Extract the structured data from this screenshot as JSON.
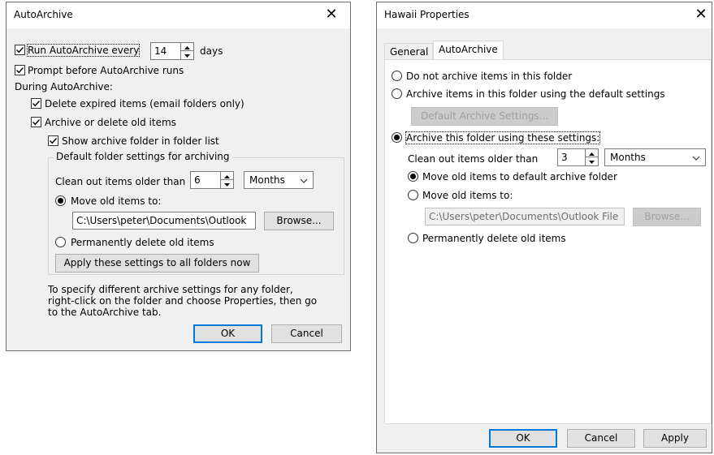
{
  "autoarchive": {
    "title": "AutoArchive",
    "run_every_label": "Run AutoArchive every",
    "run_every_value": "14",
    "days_label": "days",
    "prompt_label": "Prompt before AutoArchive runs",
    "during_label": "During AutoArchive:",
    "delete_expired_label": "Delete expired items (email folders only)",
    "archive_delete_label": "Archive or delete old items",
    "show_folder_label": "Show archive folder in folder list",
    "group_label": "Default folder settings for archiving",
    "clean_out_label": "Clean out items older than",
    "clean_out_value": "6",
    "period_value": "Months",
    "move_label": "Move old items to:",
    "path_value": "C:\\Users\\peter\\Documents\\Outlook",
    "browse_label": "Browse...",
    "perm_delete_label": "Permanently delete old items",
    "apply_all_label": "Apply these settings to all folders now",
    "info_line1": "To specify different archive settings for any folder,",
    "info_line2": "right-click on the folder and choose Properties, then go",
    "info_line3": "to the AutoArchive tab.",
    "ok_label": "OK",
    "cancel_label": "Cancel"
  },
  "properties": {
    "title": "Hawaii Properties",
    "tabs": [
      {
        "label": "General",
        "active": false
      },
      {
        "label": "AutoArchive",
        "active": true
      }
    ],
    "no_archive_label": "Do not archive items in this folder",
    "default_settings_label": "Archive items in this folder using the default settings",
    "default_archive_btn": "Default Archive Settings...",
    "these_settings_label": "Archive this folder using these settings:",
    "clean_out_label": "Clean out items older than",
    "clean_out_value": "3",
    "period_value": "Months",
    "move_default_label": "Move old items to default archive folder",
    "move_label": "Move old items to:",
    "path_value": "C:\\Users\\peter\\Documents\\Outlook File",
    "browse_label": "Browse...",
    "perm_delete_label": "Permanently delete old items",
    "ok_label": "OK",
    "cancel_label": "Cancel",
    "apply_label": "Apply"
  },
  "colors": {
    "dialog_bg": "#f0f0f0",
    "accent": "#0078d7",
    "disabled_text": "#a0a0a0"
  }
}
